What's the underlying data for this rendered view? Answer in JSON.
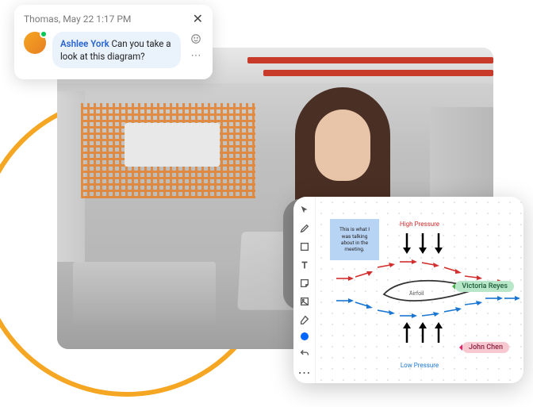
{
  "chat": {
    "timestamp": "Thomas, May 22 1:17 PM",
    "mention": "Ashlee York",
    "message": "Can you take a look at this diagram?"
  },
  "whiteboard": {
    "sticky_note": "This is what I was talking about in the meeting.",
    "label_high_pressure": "High Pressure",
    "label_low_pressure": "Low Pressure",
    "label_airfoil": "Airfoil",
    "cursors": {
      "victoria": "Victoria Reyes",
      "john": "John Chen"
    }
  }
}
